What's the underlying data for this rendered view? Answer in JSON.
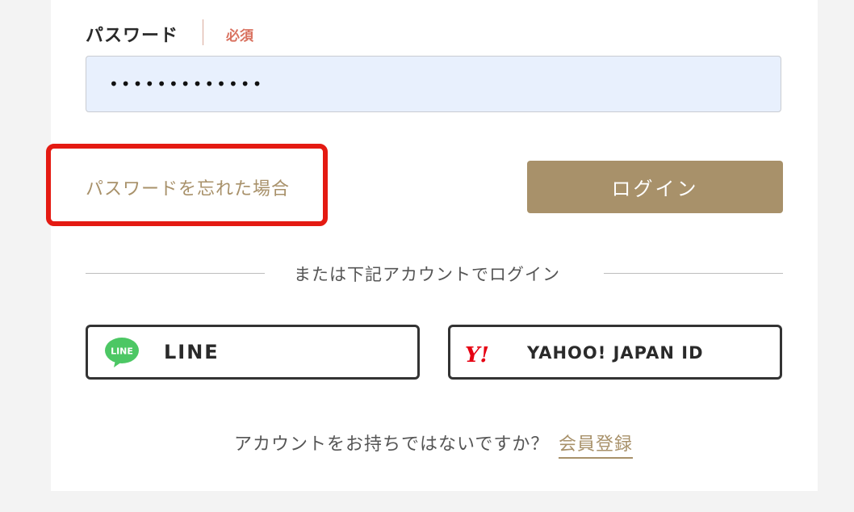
{
  "password_field": {
    "label": "パスワード",
    "required_badge": "必須",
    "value_masked": "•••••••••••••"
  },
  "forgot_password_link": "パスワードを忘れた場合",
  "login_button_label": "ログイン",
  "divider_text": "または下記アカウントでログイン",
  "social_logins": {
    "line": {
      "label": "LINE",
      "icon": "line-logo-icon",
      "icon_text": "LINE",
      "color": "#4cc764"
    },
    "yahoo": {
      "label": "YAHOO! JAPAN ID",
      "icon": "yahoo-japan-logo-icon",
      "icon_text": "Y!",
      "color": "#e60012"
    }
  },
  "signup": {
    "prompt": "アカウントをお持ちではないですか？",
    "link_label": "会員登録"
  },
  "colors": {
    "accent_gold": "#a8916a",
    "required_red": "#d9715f",
    "highlight_red": "#e41a12",
    "input_bg": "#e8f0fd"
  }
}
